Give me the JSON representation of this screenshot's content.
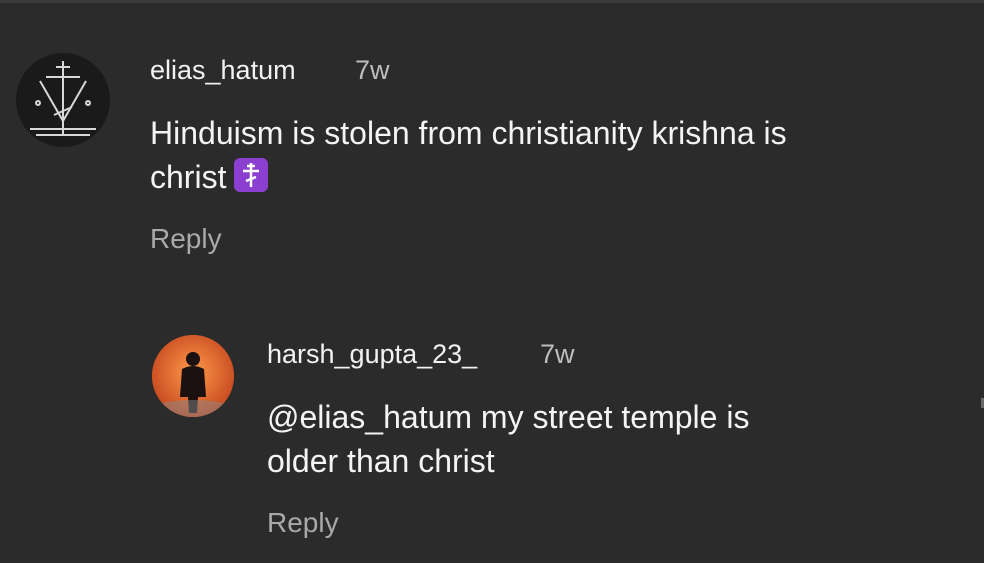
{
  "comments": [
    {
      "username": "elias_hatum",
      "time": "7w",
      "text_line1": "Hinduism is stolen from christianity krishna is",
      "text_line2": "christ",
      "emoji": "orthodox-cross-emoji",
      "reply_label": "Reply",
      "avatar_icon": "orthodox-cross-avatar-icon"
    },
    {
      "username": "harsh_gupta_23_",
      "time": "7w",
      "text_line1": "@elias_hatum my street temple is",
      "text_line2": "older than christ",
      "reply_label": "Reply",
      "avatar_icon": "person-photo-avatar-icon"
    }
  ],
  "colors": {
    "background": "#2b2b2b",
    "text": "#f4f4f4",
    "muted": "#a9a9a9",
    "emoji_bg": "#8a3fd0",
    "avatar2_bg": "#e0662e"
  }
}
